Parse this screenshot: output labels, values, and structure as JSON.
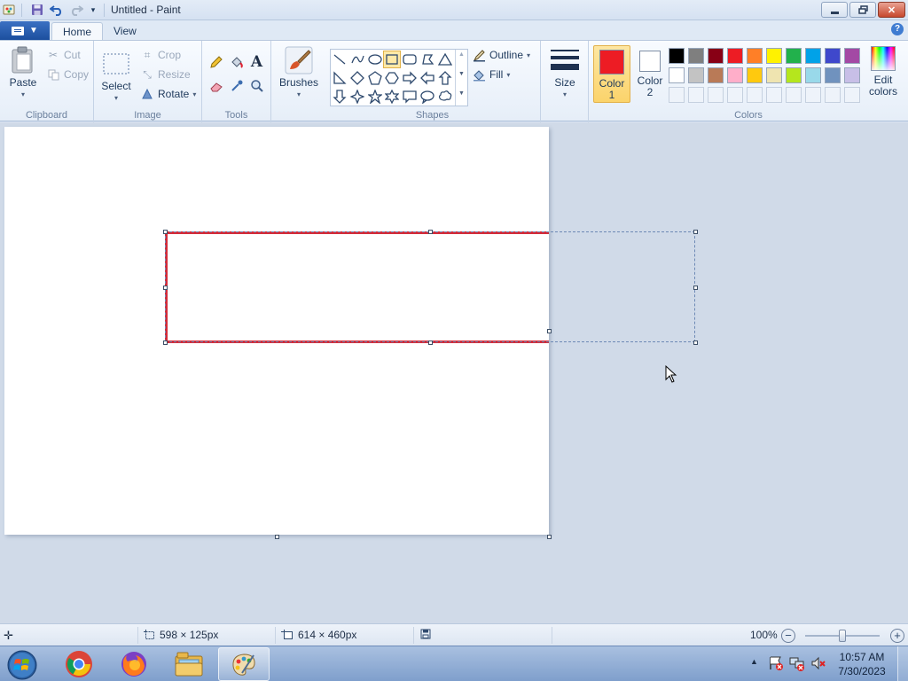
{
  "window": {
    "title": "Untitled - Paint",
    "minimize_icon": "minimize-icon",
    "maximize_icon": "restore-icon",
    "close_icon": "close-icon"
  },
  "tabs": [
    {
      "label": "Home",
      "active": true
    },
    {
      "label": "View",
      "active": false
    }
  ],
  "ribbon": {
    "clipboard": {
      "label": "Clipboard",
      "paste": "Paste",
      "cut": "Cut",
      "copy": "Copy"
    },
    "image": {
      "label": "Image",
      "select": "Select",
      "crop": "Crop",
      "resize": "Resize",
      "rotate": "Rotate"
    },
    "tools": {
      "label": "Tools"
    },
    "brushes": {
      "label": "Brushes"
    },
    "shapes": {
      "label": "Shapes",
      "outline": "Outline",
      "fill": "Fill"
    },
    "size": {
      "label": "Size"
    },
    "colors": {
      "label": "Colors",
      "color1_line1": "Color",
      "color1_line2": "1",
      "color2_line1": "Color",
      "color2_line2": "2",
      "edit_line1": "Edit",
      "edit_line2": "colors",
      "color1_value": "#ed1c24",
      "color2_value": "#ffffff",
      "palette_row1": [
        "#000000",
        "#7f7f7f",
        "#880015",
        "#ed1c24",
        "#ff7f27",
        "#fff200",
        "#22b14c",
        "#00a2e8",
        "#3f48cc",
        "#a349a4"
      ],
      "palette_row2": [
        "#ffffff",
        "#c3c3c3",
        "#b97a57",
        "#ffaec9",
        "#ffc90e",
        "#efe4b0",
        "#b5e61d",
        "#99d9ea",
        "#7092be",
        "#c8bfe7"
      ]
    }
  },
  "statusbar": {
    "selection_size": "598 × 125px",
    "canvas_size": "614 × 460px",
    "zoom": "100%"
  },
  "taskbar": {
    "apps": [
      "chrome-icon",
      "firefox-icon",
      "file-explorer-icon",
      "paint-icon"
    ],
    "time": "10:57 AM",
    "date": "7/30/2023"
  }
}
